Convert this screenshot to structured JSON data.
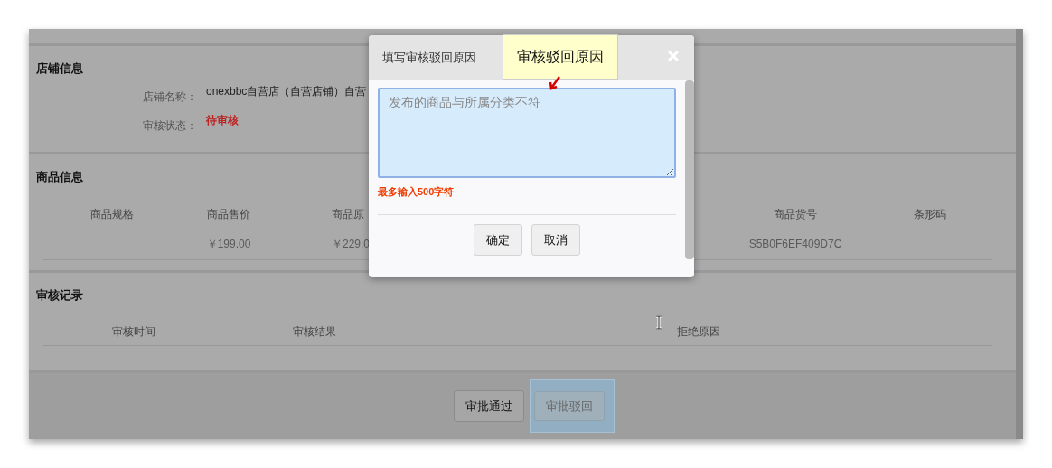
{
  "shop_info": {
    "title": "店铺信息",
    "fields": [
      {
        "label": "店铺名称：",
        "value": "onexbbc自营店（自营店铺）自营",
        "kind": "text"
      },
      {
        "label": "审核状态：",
        "value": "待审核",
        "kind": "status"
      }
    ]
  },
  "goods_info": {
    "title": "商品信息",
    "table": {
      "columns": [
        "商品规格",
        "商品售价",
        "商品原",
        "商品货号",
        "条形码"
      ],
      "rows": [
        [
          null,
          "￥199.00",
          "￥229.0",
          "S5B0F6EF409D7C",
          null
        ]
      ]
    }
  },
  "audit_log": {
    "title": "审核记录",
    "table": {
      "columns": [
        "审核时间",
        "审核结果",
        "拒绝原因"
      ]
    }
  },
  "footer_buttons": [
    {
      "label": "审批通过",
      "highlighted": false
    },
    {
      "label": "审批驳回",
      "highlighted": true
    }
  ],
  "dialog": {
    "title": "填写审核驳回原因",
    "reason": {
      "placeholder": "发布的商品与所属分类不符"
    },
    "hint": "最多输入500字符",
    "buttons": [
      "确定",
      "取消"
    ]
  },
  "tooltip": {
    "text": "审核驳回原因"
  }
}
